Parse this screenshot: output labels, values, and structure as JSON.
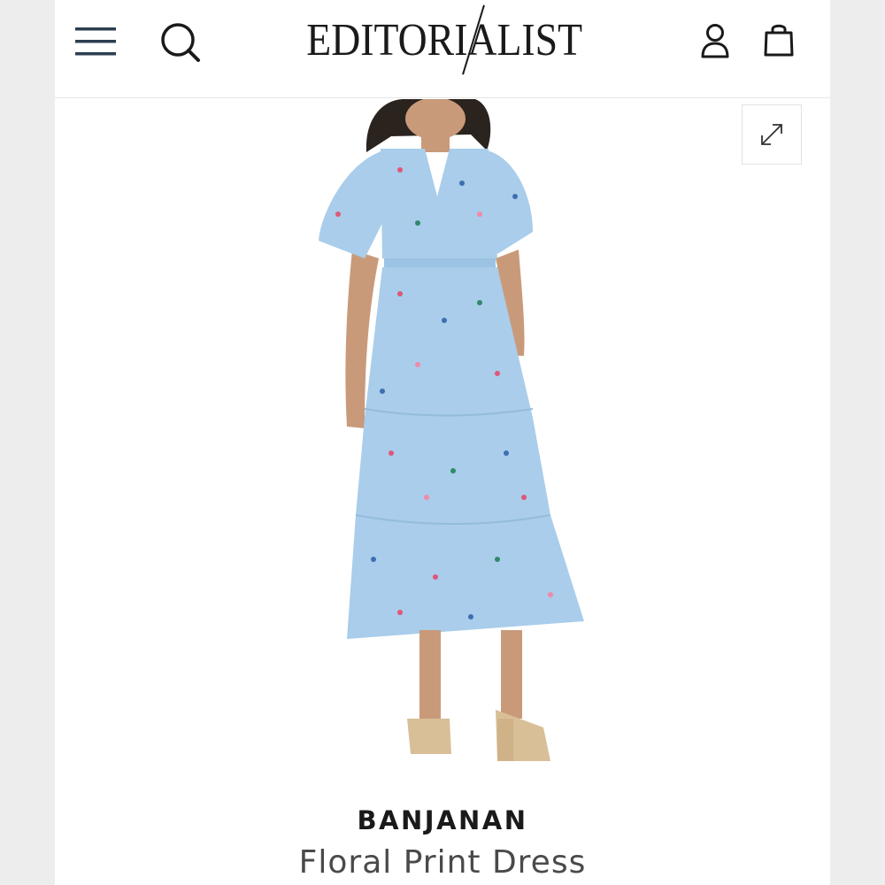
{
  "header": {
    "logo": "EDITORIALIST",
    "icons": {
      "menu": "hamburger-menu-icon",
      "search": "search-icon",
      "account": "user-icon",
      "bag": "shopping-bag-icon"
    }
  },
  "gallery": {
    "expand_icon": "expand-arrows-icon",
    "dress_color": "#a9cdea",
    "print_colors": [
      "#e0567a",
      "#3d6fb0",
      "#2f8a6a",
      "#f08aa8"
    ]
  },
  "product": {
    "brand": "BANJANAN",
    "name": "Floral Print Dress"
  },
  "colors": {
    "text": "#1a1a1a",
    "muted_text": "#4a4a4a",
    "icon_navy": "#2c3e50"
  }
}
